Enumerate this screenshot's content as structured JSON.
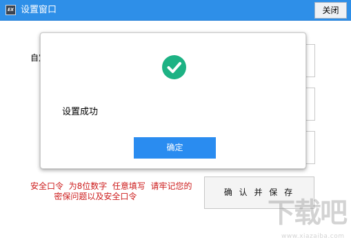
{
  "window": {
    "title": "设置窗口",
    "icon_label": "EX",
    "close_label": "关闭"
  },
  "form": {
    "label_partial": "自定"
  },
  "notice": {
    "text": "安全口令  为8位数字  任意填写  请牢记您的\n         密保问题以及安全口令"
  },
  "buttons": {
    "confirm_save": "确 认 并 保 存"
  },
  "dialog": {
    "icon": "check-circle-icon",
    "message": "设置成功",
    "ok_label": "确定"
  },
  "watermark": {
    "text": "下载吧",
    "url": "www.xiazaiba.com"
  },
  "colors": {
    "titlebar": "#2e8fe8",
    "success_green": "#1db284",
    "primary_button": "#2a8cf0",
    "notice_red": "#cc1a1a"
  }
}
